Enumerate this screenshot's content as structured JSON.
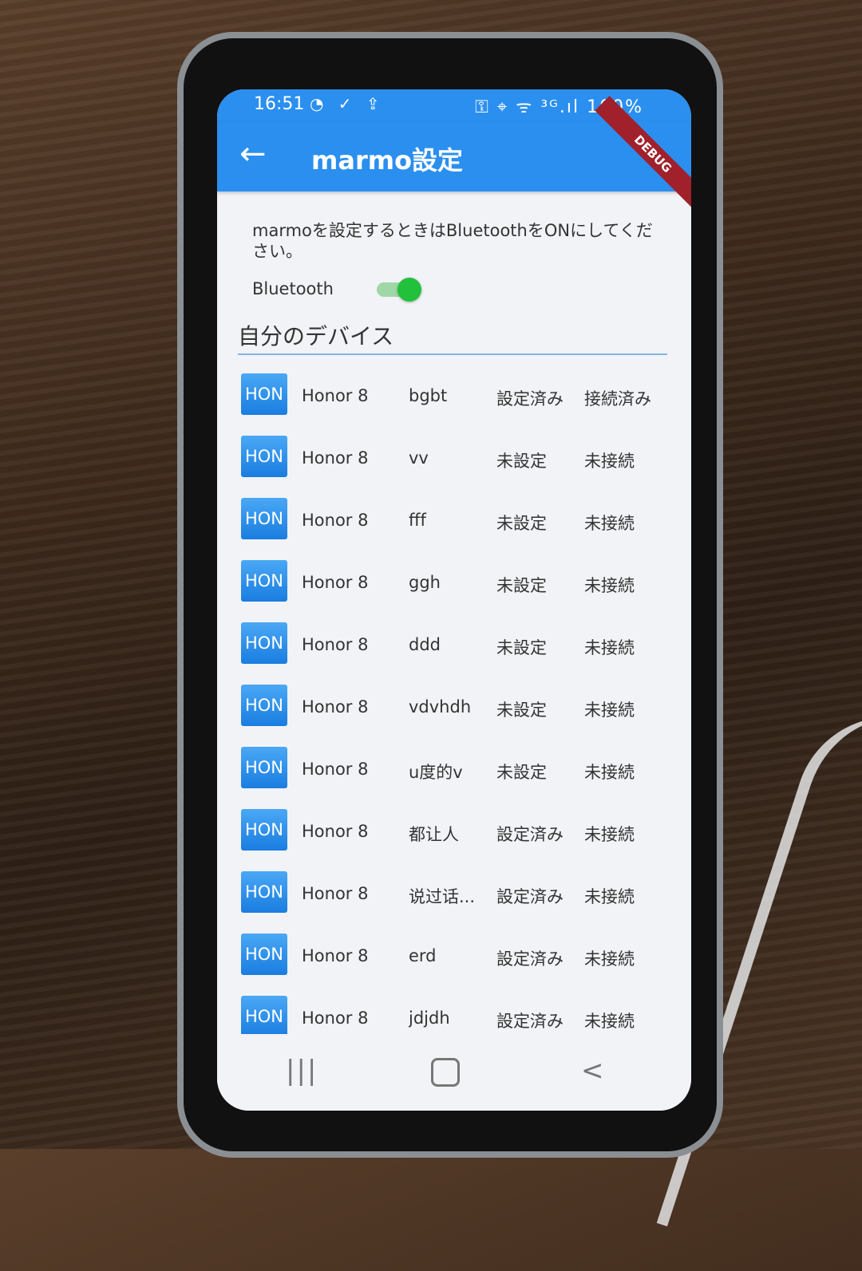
{
  "status_bar": {
    "time": "16:51",
    "left_icons": "◔ ✓ ⇪",
    "right": "⚿ ⌖ ᯤ ³ᴳ.ıl 100%"
  },
  "app_bar": {
    "back_icon": "←",
    "title": "marmo設定",
    "debug_banner": "DEBUG"
  },
  "instruction": "marmoを設定するときはBluetoothをONにしてください。",
  "bluetooth": {
    "label": "Bluetooth",
    "enabled": true
  },
  "section_title": "自分のデバイス",
  "devices": [
    {
      "avatar": "HON",
      "model": "Honor 8",
      "name": "bgbt",
      "setup": "設定済み",
      "connection": "接続済み"
    },
    {
      "avatar": "HON",
      "model": "Honor 8",
      "name": "vv",
      "setup": "未設定",
      "connection": "未接続"
    },
    {
      "avatar": "HON",
      "model": "Honor 8",
      "name": "fff",
      "setup": "未設定",
      "connection": "未接続"
    },
    {
      "avatar": "HON",
      "model": "Honor 8",
      "name": "ggh",
      "setup": "未設定",
      "connection": "未接続"
    },
    {
      "avatar": "HON",
      "model": "Honor 8",
      "name": "ddd",
      "setup": "未設定",
      "connection": "未接続"
    },
    {
      "avatar": "HON",
      "model": "Honor 8",
      "name": "vdvhdh",
      "setup": "未設定",
      "connection": "未接続"
    },
    {
      "avatar": "HON",
      "model": "Honor 8",
      "name": "u度的v",
      "setup": "未設定",
      "connection": "未接続"
    },
    {
      "avatar": "HON",
      "model": "Honor 8",
      "name": "都让人",
      "setup": "設定済み",
      "connection": "未接続"
    },
    {
      "avatar": "HON",
      "model": "Honor 8",
      "name": "说过话...",
      "setup": "設定済み",
      "connection": "未接続"
    },
    {
      "avatar": "HON",
      "model": "Honor 8",
      "name": "erd",
      "setup": "設定済み",
      "connection": "未接続"
    },
    {
      "avatar": "HON",
      "model": "Honor 8",
      "name": "jdjdh",
      "setup": "設定済み",
      "connection": "未接続"
    }
  ],
  "nav_bar": {
    "recent_icon": "|||",
    "home_icon": "",
    "back_icon": "<"
  }
}
